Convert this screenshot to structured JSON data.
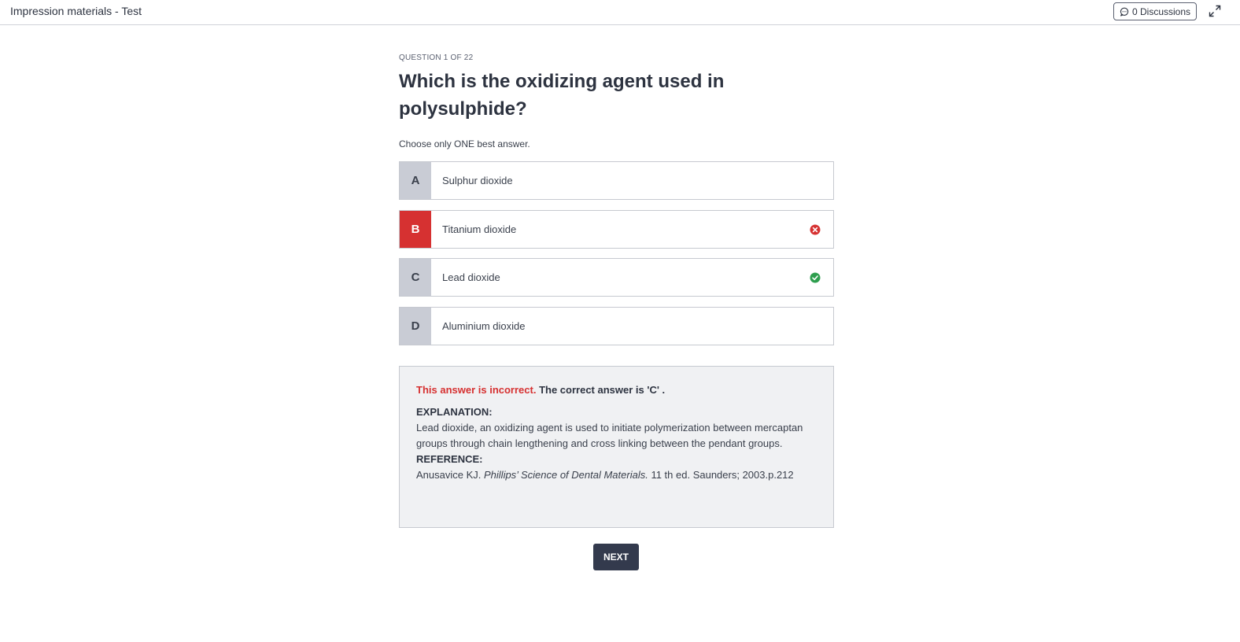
{
  "header": {
    "title": "Impression materials - Test",
    "discussions_label": "0 Discussions",
    "discussion_icon": "chat-bubble-icon",
    "expand_icon": "expand-arrows-icon"
  },
  "question": {
    "counter": "QUESTION 1 OF 22",
    "text": "Which is the oxidizing agent used in polysulphide?",
    "instruction": "Choose only ONE best answer."
  },
  "options": [
    {
      "letter": "A",
      "text": "Sulphur dioxide",
      "state": "none"
    },
    {
      "letter": "B",
      "text": "Titanium dioxide",
      "state": "incorrect"
    },
    {
      "letter": "C",
      "text": "Lead dioxide",
      "state": "correct"
    },
    {
      "letter": "D",
      "text": "Aluminium dioxide",
      "state": "none"
    }
  ],
  "feedback": {
    "incorrect_label": "This answer is incorrect.",
    "correct_answer_text": "The correct answer is 'C' .",
    "explanation_heading": "EXPLANATION:",
    "explanation_text": "Lead dioxide, an oxidizing agent is used to initiate polymerization between mercaptan groups through chain lengthening and cross linking between the pendant groups.",
    "reference_heading": "REFERENCE:",
    "reference_author": "Anusavice KJ.",
    "reference_book": "Phillips’ Science of Dental Materials.",
    "reference_rest": "11 th ed. Saunders; 2003.p.212"
  },
  "next_label": "NEXT",
  "colors": {
    "wrong": "#d63131",
    "correct": "#2e9e4e",
    "next_button": "#333a4d",
    "letter_bg": "#c9ccd5",
    "feedback_bg": "#f0f1f3"
  }
}
